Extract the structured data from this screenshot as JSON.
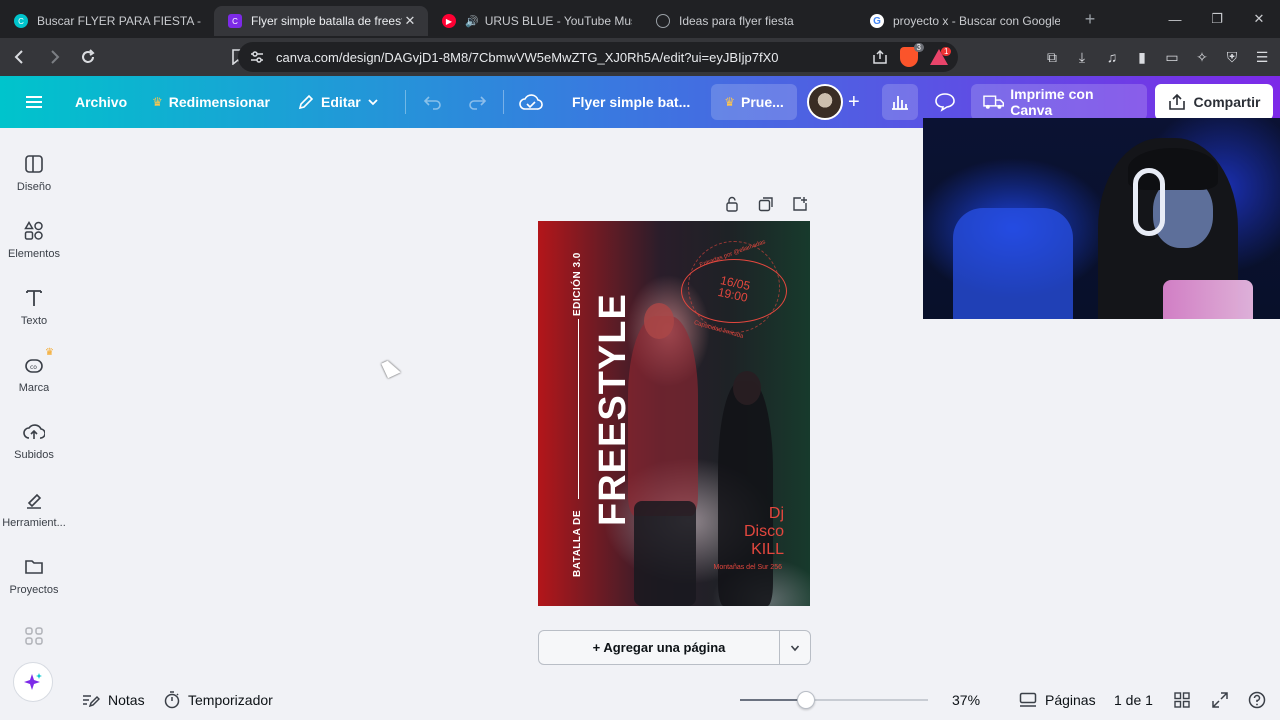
{
  "browser": {
    "tabs": [
      {
        "title": "Buscar FLYER PARA FIESTA - Canva",
        "favicon_color": "#00c4cc",
        "active": false
      },
      {
        "title": "Flyer simple batalla de freestyle",
        "favicon_color": "#7d2ae8",
        "active": true,
        "close": "✕"
      },
      {
        "title": "URUS BLUE - YouTube Music",
        "favicon_color": "#ff0033",
        "active": false
      },
      {
        "title": "Ideas para flyer fiesta",
        "favicon_color": "#9aa0a6",
        "active": false
      },
      {
        "title": "proyecto x - Buscar con Google",
        "favicon_color": "#4285f4",
        "active": false
      }
    ],
    "new_tab": "+",
    "url": "canva.com/design/DAGvjD1-8M8/7CbmwVW5eMwZTG_XJ0Rh5A/edit?ui=eyJBIjp7fX0",
    "brave_badge": "3",
    "rewards_badge": "1"
  },
  "canva_header": {
    "archivo": "Archivo",
    "redimensionar": "Redimensionar",
    "editar": "Editar",
    "design_title": "Flyer simple bat...",
    "pro": "Prue...",
    "print": "Imprime con Canva",
    "share": "Compartir"
  },
  "sidebar": {
    "items": [
      {
        "label": "Diseño",
        "icon": "layout-icon"
      },
      {
        "label": "Elementos",
        "icon": "shapes-icon"
      },
      {
        "label": "Texto",
        "icon": "text-icon"
      },
      {
        "label": "Marca",
        "icon": "brand-icon"
      },
      {
        "label": "Subidos",
        "icon": "cloud-upload-icon"
      },
      {
        "label": "Herramient...",
        "icon": "tools-icon"
      },
      {
        "label": "Proyectos",
        "icon": "folder-icon"
      }
    ]
  },
  "flyer": {
    "edicion": "EDICIÓN 3.0",
    "freestyle": "FREESTYLE",
    "batalla": "BATALLA DE",
    "date_line1": "16/05",
    "date_line2": "19:00",
    "entradas": "Entradas por @ellamadas",
    "cupo": "Capacidad limitada",
    "dj_line1": "Dj",
    "dj_line2": "Disco",
    "dj_line3": "KILL",
    "address": "Montañas del Sur 256"
  },
  "canvas": {
    "add_page": "+ Agregar una página"
  },
  "footer": {
    "notas": "Notas",
    "temporizador": "Temporizador",
    "zoom_value": 37,
    "zoom_label": "37%",
    "paginas": "Páginas",
    "page_count": "1 de 1"
  },
  "colors": {
    "header_start": "#00c4cc",
    "header_mid": "#3a78e0",
    "header_end": "#7d2ae8",
    "flyer_accent": "#e3473e"
  }
}
